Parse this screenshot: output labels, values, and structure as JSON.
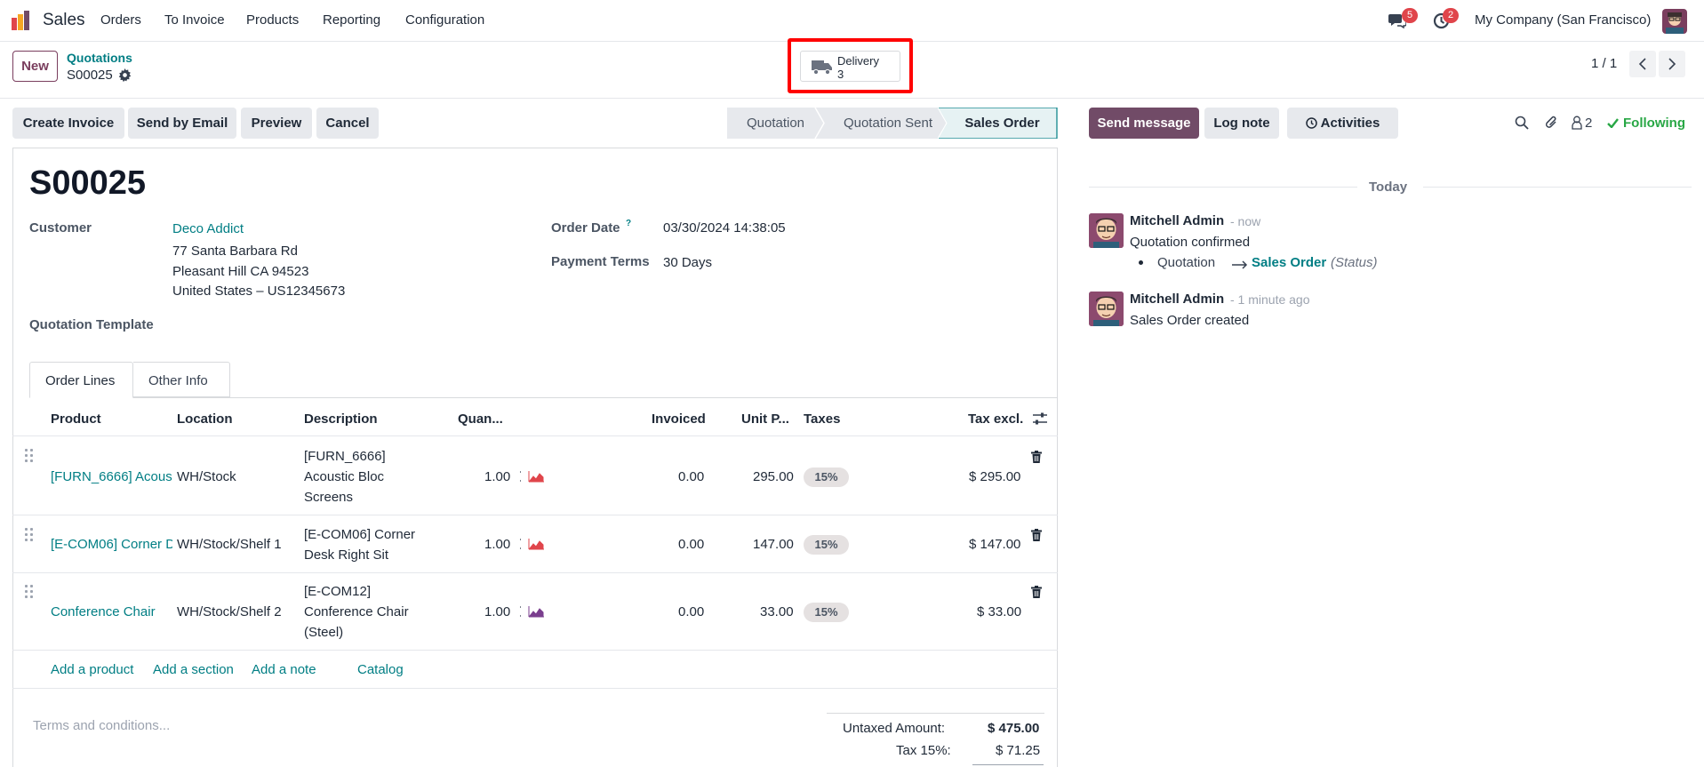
{
  "navbar": {
    "app_name": "Sales",
    "menu": [
      "Orders",
      "To Invoice",
      "Products",
      "Reporting",
      "Configuration"
    ],
    "messages_count": "5",
    "activities_count": "2",
    "company": "My Company (San Francisco)"
  },
  "control": {
    "new_label": "New",
    "breadcrumb_parent": "Quotations",
    "record_name": "S00025",
    "smart_button": {
      "label": "Delivery",
      "count": "3"
    },
    "pager": "1 / 1"
  },
  "actions": {
    "create_invoice": "Create Invoice",
    "send_email": "Send by Email",
    "preview": "Preview",
    "cancel": "Cancel"
  },
  "statusbar": {
    "steps": [
      "Quotation",
      "Quotation Sent",
      "Sales Order"
    ],
    "active": "Sales Order"
  },
  "form": {
    "title": "S00025",
    "customer_label": "Customer",
    "customer_name": "Deco Addict",
    "address_line1": "77 Santa Barbara Rd",
    "address_line2": "Pleasant Hill CA 94523",
    "address_line3": "United States – US12345673",
    "template_label": "Quotation Template",
    "order_date_label": "Order Date",
    "order_date_help": "?",
    "order_date": "03/30/2024 14:38:05",
    "payment_terms_label": "Payment Terms",
    "payment_terms": "30 Days"
  },
  "tabs": [
    "Order Lines",
    "Other Info"
  ],
  "order_lines": {
    "headers": {
      "product": "Product",
      "location": "Location",
      "description": "Description",
      "quantity": "Quan...",
      "invoiced": "Invoiced",
      "unit_price": "Unit P...",
      "taxes": "Taxes",
      "tax_excl": "Tax excl."
    },
    "rows": [
      {
        "product": "[FURN_6666] Acous",
        "location": "WH/Stock",
        "description": [
          "[FURN_6666]",
          "Acoustic Bloc",
          "Screens"
        ],
        "quantity": "1.00",
        "invoiced": "0.00",
        "unit_price": "295.00",
        "tax": "15%",
        "subtotal": "$ 295.00",
        "forecast_color": "#e0454b"
      },
      {
        "product": "[E-COM06] Corner D",
        "location": "WH/Stock/Shelf 1",
        "description": [
          "[E-COM06] Corner",
          "Desk Right Sit"
        ],
        "quantity": "1.00",
        "invoiced": "0.00",
        "unit_price": "147.00",
        "tax": "15%",
        "subtotal": "$ 147.00",
        "forecast_color": "#e0454b"
      },
      {
        "product": "Conference Chair",
        "location": "WH/Stock/Shelf 2",
        "description": [
          "[E-COM12]",
          "Conference Chair",
          "(Steel)"
        ],
        "quantity": "1.00",
        "invoiced": "0.00",
        "unit_price": "33.00",
        "tax": "15%",
        "subtotal": "$ 33.00",
        "forecast_color": "#7a3e8e"
      }
    ],
    "add_product": "Add a product",
    "add_section": "Add a section",
    "add_note": "Add a note",
    "catalog": "Catalog"
  },
  "footer": {
    "terms_placeholder": "Terms and conditions...",
    "untaxed_label": "Untaxed Amount:",
    "untaxed_value": "$ 475.00",
    "tax_label": "Tax 15%:",
    "tax_value": "$ 71.25"
  },
  "chatter": {
    "send_message": "Send message",
    "log_note": "Log note",
    "activities": "Activities",
    "followers_count": "2",
    "following": "Following",
    "date_separator": "Today",
    "messages": [
      {
        "author": "Mitchell Admin",
        "time": "- now",
        "body": "Quotation confirmed",
        "tracking_old": "Quotation",
        "tracking_new": "Sales Order",
        "tracking_field": "(Status)"
      },
      {
        "author": "Mitchell Admin",
        "time": "- 1 minute ago",
        "body": "Sales Order created"
      }
    ]
  },
  "colors": {
    "primary": "#714b67",
    "link": "#017e84",
    "following": "#28a745",
    "highlight": "#ff0000"
  }
}
